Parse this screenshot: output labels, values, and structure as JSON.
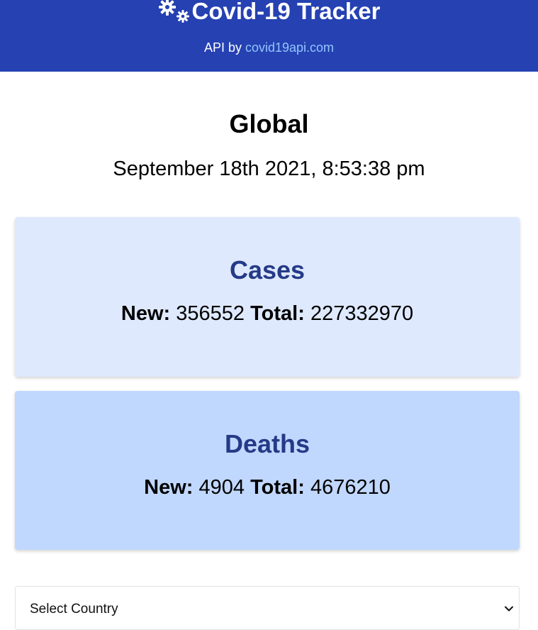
{
  "header": {
    "logo_icon": "gears-icon",
    "title": "Covid-19 Tracker",
    "api_prefix": "API by",
    "api_link": "covid19api.com",
    "background_color": "#2541b2",
    "link_color": "#93c5fd"
  },
  "global": {
    "title": "Global",
    "date": "September 18th 2021, 8:53:38 pm"
  },
  "cards": {
    "cases": {
      "title": "Cases",
      "new_label": "New:",
      "new_value": "356552",
      "total_label": "Total:",
      "total_value": "227332970",
      "background_color": "#dfe9fd"
    },
    "deaths": {
      "title": "Deaths",
      "new_label": "New:",
      "new_value": "4904",
      "total_label": "Total:",
      "total_value": "4676210",
      "background_color": "#c1d8fe"
    }
  },
  "country_select": {
    "selected": "Select Country",
    "icon": "chevron-down-icon"
  }
}
